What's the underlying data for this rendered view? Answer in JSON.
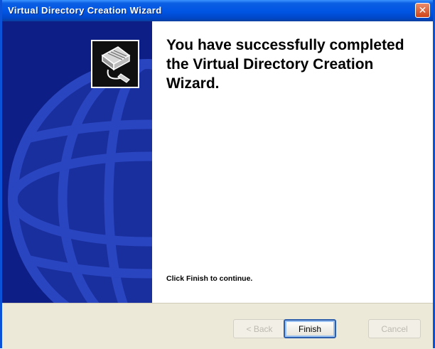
{
  "window": {
    "title": "Virtual Directory Creation Wizard",
    "close_glyph": "✕"
  },
  "main": {
    "heading": "You have successfully completed the Virtual Directory Creation Wizard.",
    "instruction": "Click Finish to continue."
  },
  "buttons": {
    "back": "< Back",
    "finish": "Finish",
    "cancel": "Cancel"
  },
  "colors": {
    "title_bar": "#0054e3",
    "side_panel": "#0d1e87",
    "globe": "#2a45c0",
    "dialog_face": "#ece9d8"
  },
  "icons": {
    "close": "close-icon",
    "wizard": "book-wizard-icon",
    "globe": "globe-graphic"
  }
}
